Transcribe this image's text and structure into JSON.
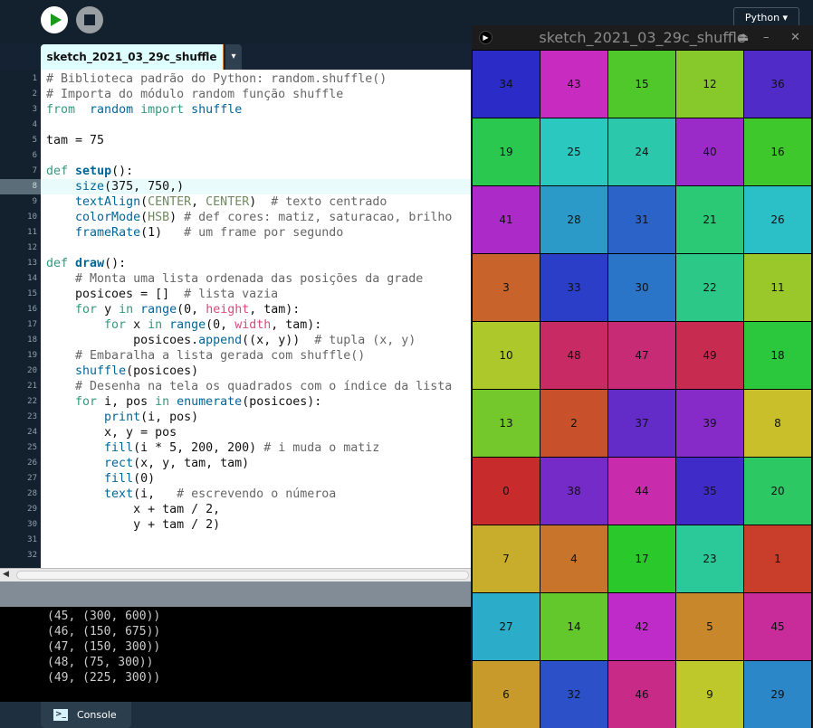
{
  "toolbar": {
    "run_icon": "play-icon",
    "stop_icon": "stop-icon",
    "mode_label": "Python ▾"
  },
  "editor": {
    "tab_label": "sketch_2021_03_29c_shuffle",
    "tab_menu": "▾",
    "current_line": 8,
    "lines": [
      [
        [
          "c",
          "# Biblioteca padrão do Python: random.shuffle()"
        ]
      ],
      [
        [
          "c",
          "# Importa do módulo random função shuffle"
        ]
      ],
      [
        [
          "k",
          "from"
        ],
        [
          "",
          "  "
        ],
        [
          "f",
          "random"
        ],
        [
          "",
          " "
        ],
        [
          "k",
          "import"
        ],
        [
          "",
          " "
        ],
        [
          "f",
          "shuffle"
        ]
      ],
      [],
      [
        [
          "",
          "tam = 75"
        ]
      ],
      [],
      [
        [
          "k",
          "def"
        ],
        [
          "",
          " "
        ],
        [
          "fb",
          "setup"
        ],
        [
          "",
          "():"
        ]
      ],
      [
        [
          "",
          "    "
        ],
        [
          "f",
          "size"
        ],
        [
          "",
          "(375, 750,)"
        ]
      ],
      [
        [
          "",
          "    "
        ],
        [
          "f",
          "textAlign"
        ],
        [
          "",
          "("
        ],
        [
          "const",
          "CENTER"
        ],
        [
          "",
          ", "
        ],
        [
          "const",
          "CENTER"
        ],
        [
          "",
          ")  "
        ],
        [
          "c",
          "# texto centrado"
        ]
      ],
      [
        [
          "",
          "    "
        ],
        [
          "f",
          "colorMode"
        ],
        [
          "",
          "("
        ],
        [
          "const",
          "HSB"
        ],
        [
          "",
          ") "
        ],
        [
          "c",
          "# def cores: matiz, saturacao, brilho"
        ]
      ],
      [
        [
          "",
          "    "
        ],
        [
          "f",
          "frameRate"
        ],
        [
          "",
          "(1)   "
        ],
        [
          "c",
          "# um frame por segundo"
        ]
      ],
      [],
      [
        [
          "k",
          "def"
        ],
        [
          "",
          " "
        ],
        [
          "fb",
          "draw"
        ],
        [
          "",
          "():"
        ]
      ],
      [
        [
          "",
          "    "
        ],
        [
          "c",
          "# Monta uma lista ordenada das posições da grade"
        ]
      ],
      [
        [
          "",
          "    posicoes = []  "
        ],
        [
          "c",
          "# lista vazia"
        ]
      ],
      [
        [
          "",
          "    "
        ],
        [
          "k",
          "for"
        ],
        [
          "",
          " y "
        ],
        [
          "k",
          "in"
        ],
        [
          "",
          " "
        ],
        [
          "f",
          "range"
        ],
        [
          "",
          "(0, "
        ],
        [
          "v",
          "height"
        ],
        [
          "",
          ", tam):"
        ]
      ],
      [
        [
          "",
          "        "
        ],
        [
          "k",
          "for"
        ],
        [
          "",
          " x "
        ],
        [
          "k",
          "in"
        ],
        [
          "",
          " "
        ],
        [
          "f",
          "range"
        ],
        [
          "",
          "(0, "
        ],
        [
          "v",
          "width"
        ],
        [
          "",
          ", tam):"
        ]
      ],
      [
        [
          "",
          "            posicoes."
        ],
        [
          "f",
          "append"
        ],
        [
          "",
          "((x, y))  "
        ],
        [
          "c",
          "# tupla (x, y)"
        ]
      ],
      [
        [
          "",
          "    "
        ],
        [
          "c",
          "# Embaralha a lista gerada com shuffle()"
        ]
      ],
      [
        [
          "",
          "    "
        ],
        [
          "f",
          "shuffle"
        ],
        [
          "",
          "(posicoes)"
        ]
      ],
      [
        [
          "",
          "    "
        ],
        [
          "c",
          "# Desenha na tela os quadrados com o índice da lista"
        ]
      ],
      [
        [
          "",
          "    "
        ],
        [
          "k",
          "for"
        ],
        [
          "",
          " i, pos "
        ],
        [
          "k",
          "in"
        ],
        [
          "",
          " "
        ],
        [
          "f",
          "enumerate"
        ],
        [
          "",
          "(posicoes):"
        ]
      ],
      [
        [
          "",
          "        "
        ],
        [
          "f",
          "print"
        ],
        [
          "",
          "(i, pos)"
        ]
      ],
      [
        [
          "",
          "        x, y = pos"
        ]
      ],
      [
        [
          "",
          "        "
        ],
        [
          "f",
          "fill"
        ],
        [
          "",
          "(i * 5, 200, 200) "
        ],
        [
          "c",
          "# i muda o matiz"
        ]
      ],
      [
        [
          "",
          "        "
        ],
        [
          "f",
          "rect"
        ],
        [
          "",
          "(x, y, tam, tam)"
        ]
      ],
      [
        [
          "",
          "        "
        ],
        [
          "f",
          "fill"
        ],
        [
          "",
          "(0)"
        ]
      ],
      [
        [
          "",
          "        "
        ],
        [
          "f",
          "text"
        ],
        [
          "",
          "(i,   "
        ],
        [
          "c",
          "# escrevendo o númeroa"
        ]
      ],
      [
        [
          "",
          "            x + tam / 2,"
        ]
      ],
      [
        [
          "",
          "            y + tam / 2)"
        ]
      ],
      [],
      []
    ]
  },
  "console": {
    "lines": [
      "(45, (300, 600))",
      "(46, (150, 675))",
      "(47, (150, 300))",
      "(48, (75, 300))",
      "(49, (225, 300))"
    ],
    "tab_label": "Console",
    "tab_icon": "terminal-icon",
    "tab_icon_glyph": ">_"
  },
  "sketch_window": {
    "title": "sketch_2021_03_29c_shuffle",
    "eject": "⏏",
    "minimize": "–",
    "close": "✕",
    "hsb": {
      "sat": 200,
      "bri": 200,
      "max": 255,
      "hue_step": 5
    },
    "grid": [
      [
        34,
        43,
        15,
        12,
        36
      ],
      [
        19,
        25,
        24,
        40,
        16
      ],
      [
        41,
        28,
        31,
        21,
        26
      ],
      [
        3,
        33,
        30,
        22,
        11
      ],
      [
        10,
        48,
        47,
        49,
        18
      ],
      [
        13,
        2,
        37,
        39,
        8
      ],
      [
        0,
        38,
        44,
        35,
        20
      ],
      [
        7,
        4,
        17,
        23,
        1
      ],
      [
        27,
        14,
        42,
        5,
        45
      ],
      [
        6,
        32,
        46,
        9,
        29
      ]
    ]
  }
}
